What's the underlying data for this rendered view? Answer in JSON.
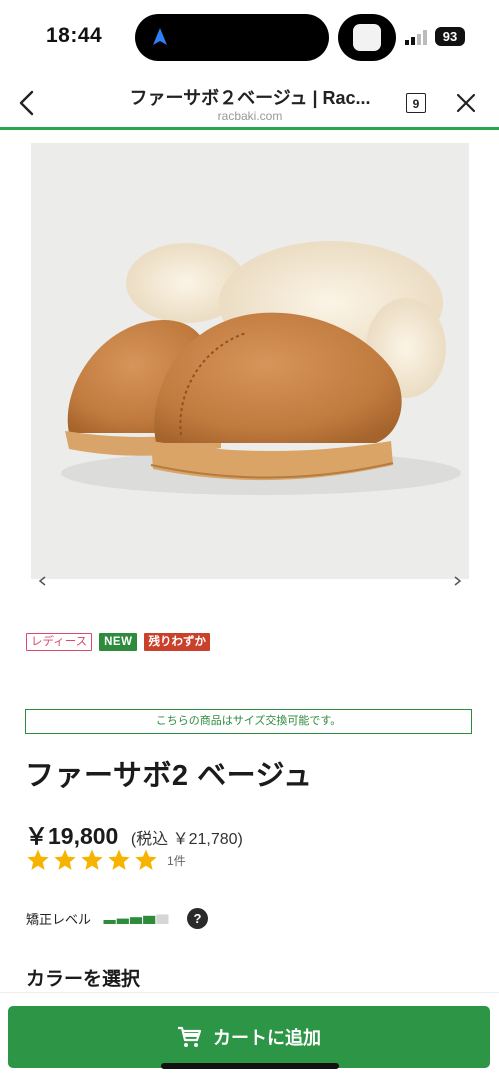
{
  "status_bar": {
    "time": "18:44",
    "battery": "93",
    "icons": [
      "navigation-arrow-icon",
      "app-thumbnail-icon",
      "signal-icon",
      "battery-icon"
    ]
  },
  "browser": {
    "title": "ファーサボ２ベージュ | Rac...",
    "domain": "racbaki.com",
    "tab_count": "9",
    "load_progress": 1.0,
    "accent_color": "#27a64a"
  },
  "product": {
    "image_alt_icon": "slipper-product-image",
    "badges": [
      "レディース",
      "NEW",
      "残りわずか"
    ],
    "exchange_note": "こちらの商品はサイズ交換可能です。",
    "name": "ファーサボ2 ベージュ",
    "price": "￥19,800",
    "tax_price": "(税込 ￥21,780)",
    "rating": 5,
    "review_count": "1件",
    "correction_label": "矯正レベル",
    "correction_level": 0.75,
    "help_icon_text": "?",
    "color_heading": "カラーを選択"
  },
  "cart": {
    "label": "カートに追加",
    "color": "#2c9546"
  }
}
